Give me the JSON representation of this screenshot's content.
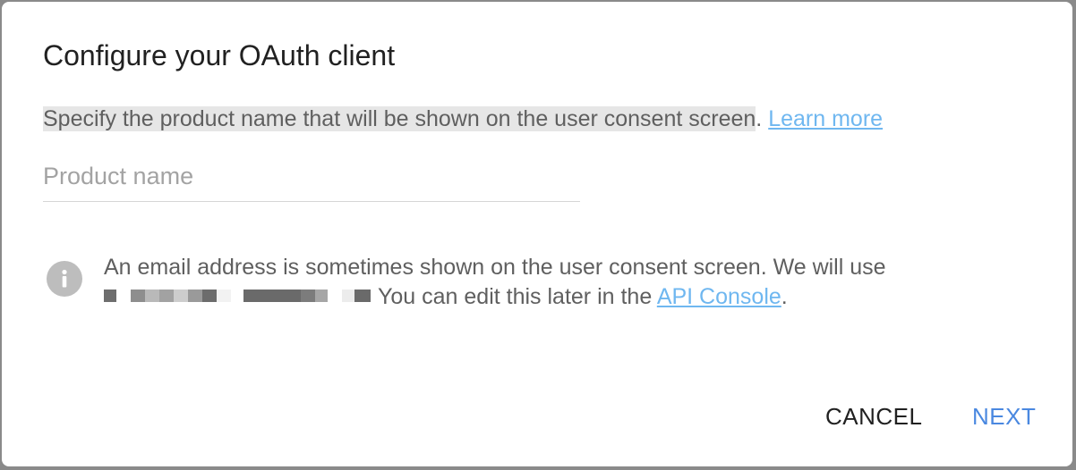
{
  "dialog": {
    "title": "Configure your OAuth client",
    "description": "Specify the product name that will be shown on the user consent screen",
    "description_end": ".",
    "learn_more_label": "Learn more",
    "product_name": {
      "value": "",
      "placeholder": "Product name"
    },
    "info": {
      "icon": "info-icon",
      "text_line1": "An email address is sometimes shown on the user consent screen. We will use",
      "redacted_email": "[redacted]",
      "text_after": "You can edit this later in the",
      "api_console_label": "API Console",
      "text_end": "."
    },
    "buttons": {
      "cancel": "CANCEL",
      "next": "NEXT"
    }
  },
  "colors": {
    "link": "#6fb7f0",
    "primary_button": "#4a88e0",
    "highlight": "#e6e6e6",
    "info_icon": "#bdbdbd"
  }
}
